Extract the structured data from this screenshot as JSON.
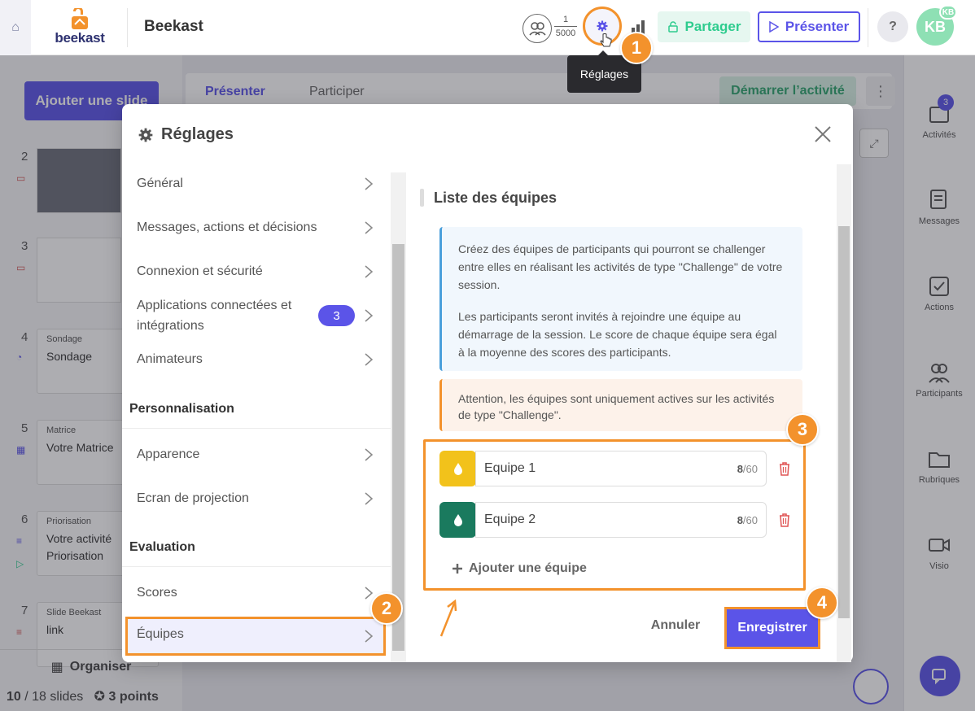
{
  "header": {
    "app_title": "Beekast",
    "logo_text": "beekast",
    "counter_current": "1",
    "counter_max": "5000",
    "share_label": "Partager",
    "present_label": "Présenter",
    "help_label": "?",
    "avatar_initials": "KB",
    "avatar_badge": "KB"
  },
  "tooltip": {
    "text": "Réglages"
  },
  "left_panel": {
    "add_slide_label": "Ajouter une slide",
    "slides": [
      {
        "num": "2"
      },
      {
        "num": "3"
      },
      {
        "num": "4",
        "type": "Sondage",
        "title": "Sondage"
      },
      {
        "num": "5",
        "type": "Matrice",
        "title": "Votre Matrice"
      },
      {
        "num": "6",
        "type": "Priorisation",
        "title": "Votre activité Priorisation"
      },
      {
        "num": "7",
        "type": "Slide Beekast",
        "title": "link"
      }
    ],
    "organiser_label": "Organiser",
    "slides_count": "10",
    "slides_total": "/ 18 slides",
    "points": "3 points"
  },
  "main": {
    "tab_present": "Présenter",
    "tab_participate": "Participer",
    "start_activity_label": "Démarrer l’activité"
  },
  "right_panel": {
    "items": [
      {
        "label": "Activités",
        "badge": "3"
      },
      {
        "label": "Messages"
      },
      {
        "label": "Actions"
      },
      {
        "label": "Participants"
      },
      {
        "label": "Rubriques"
      },
      {
        "label": "Visio"
      }
    ]
  },
  "modal": {
    "title": "Réglages",
    "menu": {
      "general": "Général",
      "messages": "Messages, actions et décisions",
      "connexion": "Connexion et sécurité",
      "apps": "Applications connectées et intégrations",
      "apps_badge": "3",
      "animateurs": "Animateurs",
      "section_personnalisation": "Personnalisation",
      "apparence": "Apparence",
      "ecran": "Ecran de projection",
      "section_evaluation": "Evaluation",
      "scores": "Scores",
      "equipes": "Équipes"
    },
    "section_title": "Liste des équipes",
    "info_p1": "Créez des équipes de participants qui pourront se challenger entre elles en réalisant les activités de type \"Challenge\" de votre session.",
    "info_p2": "Les participants seront invités à rejoindre une équipe au démarrage de la session. Le score de chaque équipe sera égal à la moyenne des scores des participants.",
    "warning": "Attention, les équipes sont uniquement actives sur les activités de type \"Challenge\".",
    "teams": [
      {
        "name": "Equipe 1",
        "count": "8",
        "max": "/60",
        "color": "#f2c21b"
      },
      {
        "name": "Equipe 2",
        "count": "8",
        "max": "/60",
        "color": "#1a7a5e"
      }
    ],
    "add_team_label": "Ajouter une équipe",
    "cancel_label": "Annuler",
    "save_label": "Enregistrer"
  },
  "steps": [
    "1",
    "2",
    "3",
    "4"
  ],
  "colors": {
    "accent": "#5b54e8",
    "highlight": "#f3922c",
    "success": "#2ecc8e"
  }
}
